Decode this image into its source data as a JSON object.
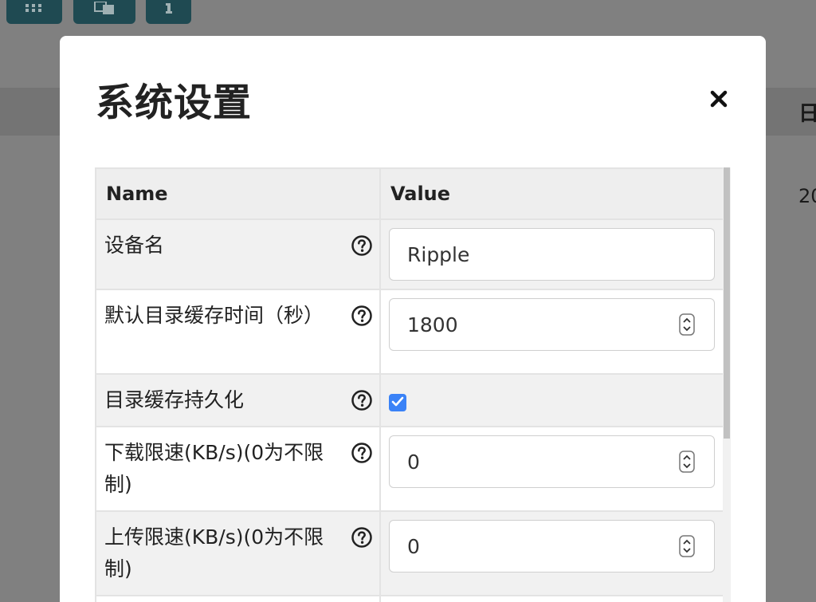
{
  "modal": {
    "title": "系统设置",
    "close_label": "×"
  },
  "background": {
    "column_head_partial": "日",
    "cell_partial": "20"
  },
  "table": {
    "headers": [
      "Name",
      "Value"
    ],
    "rows": [
      {
        "name": "设备名",
        "value": "Ripple",
        "type": "text"
      },
      {
        "name": "默认目录缓存时间（秒）",
        "value": "1800",
        "type": "number"
      },
      {
        "name": "目录缓存持久化",
        "value": true,
        "type": "checkbox"
      },
      {
        "name": "下载限速(KB/s)(0为不限制)",
        "value": "0",
        "type": "number"
      },
      {
        "name": "上传限速(KB/s)(0为不限制)",
        "value": "0",
        "type": "number"
      }
    ]
  },
  "icons": {
    "help": "question-circle-icon",
    "close": "close-icon",
    "spinner": "stepper-arrows-icon"
  },
  "colors": {
    "checkbox_accent": "#3a82f7",
    "toolbar_button": "#1f4a52",
    "overlay": "#808080"
  }
}
